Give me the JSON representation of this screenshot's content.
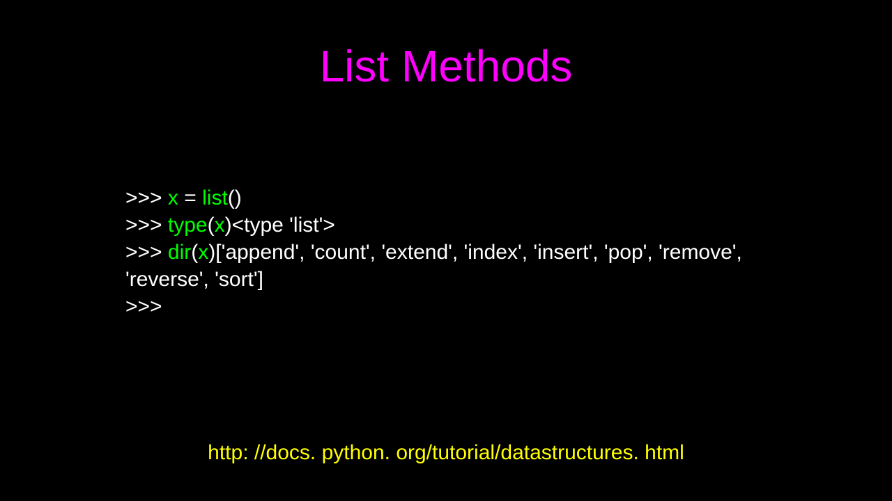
{
  "title": "List Methods",
  "code": {
    "line1": {
      "prompt": ">>> ",
      "var": "x",
      "eq": " = ",
      "fn": "list",
      "after": "()"
    },
    "line2": {
      "prompt": ">>> ",
      "fn": "type",
      "lparen": "(",
      "arg": "x",
      "rparen": ")",
      "out": "<type 'list'>"
    },
    "line3": {
      "prompt": ">>> ",
      "fn": "dir",
      "lparen": "(",
      "arg": "x",
      "rparen": ")",
      "out": "['append', 'count', 'extend', 'index', 'insert', 'pop', 'remove', 'reverse', 'sort']"
    },
    "line4": {
      "prompt": ">>> "
    }
  },
  "footer": "http: //docs. python. org/tutorial/datastructures. html"
}
